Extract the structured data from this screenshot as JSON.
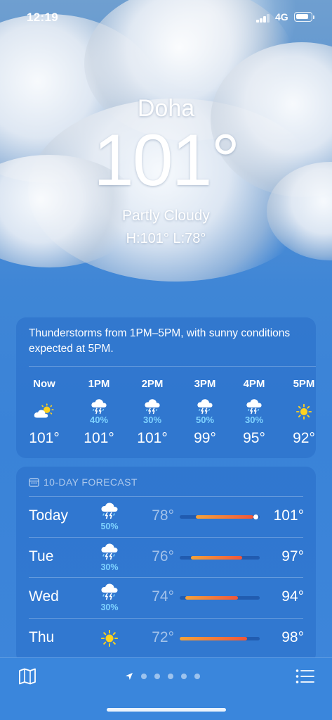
{
  "status_bar": {
    "time": "12:19",
    "network": "4G"
  },
  "location": {
    "city": "Doha",
    "temperature": "101°",
    "condition": "Partly Cloudy",
    "high_low": "H:101°  L:78°"
  },
  "hourly": {
    "summary": "Thunderstorms from 1PM–5PM, with sunny conditions expected at 5PM.",
    "hours": [
      {
        "label": "Now",
        "icon": "partly-cloudy-icon",
        "pop": "",
        "temp": "101°"
      },
      {
        "label": "1PM",
        "icon": "thunderstorm-icon",
        "pop": "40%",
        "temp": "101°"
      },
      {
        "label": "2PM",
        "icon": "thunderstorm-icon",
        "pop": "30%",
        "temp": "101°"
      },
      {
        "label": "3PM",
        "icon": "thunderstorm-icon",
        "pop": "50%",
        "temp": "99°"
      },
      {
        "label": "4PM",
        "icon": "thunderstorm-icon",
        "pop": "30%",
        "temp": "95°"
      },
      {
        "label": "5PM",
        "icon": "sun-icon",
        "pop": "",
        "temp": "92°"
      }
    ]
  },
  "forecast": {
    "title": "10-DAY FORECAST",
    "days": [
      {
        "day": "Today",
        "icon": "thunderstorm-icon",
        "pop": "50%",
        "low": "78°",
        "high": "101°",
        "range_start": 0.2,
        "range_end": 0.92,
        "current": 0.95
      },
      {
        "day": "Tue",
        "icon": "thunderstorm-icon",
        "pop": "30%",
        "low": "76°",
        "high": "97°",
        "range_start": 0.14,
        "range_end": 0.78
      },
      {
        "day": "Wed",
        "icon": "thunderstorm-icon",
        "pop": "30%",
        "low": "74°",
        "high": "94°",
        "range_start": 0.07,
        "range_end": 0.73
      },
      {
        "day": "Thu",
        "icon": "sun-icon",
        "pop": "",
        "low": "72°",
        "high": "98°",
        "range_start": 0.0,
        "range_end": 0.84
      }
    ]
  },
  "colors": {
    "pop_text": "#7fd3ff",
    "range_warm": "#f4a33a",
    "range_hot": "#f0563a",
    "sun": "#ffd21f"
  }
}
